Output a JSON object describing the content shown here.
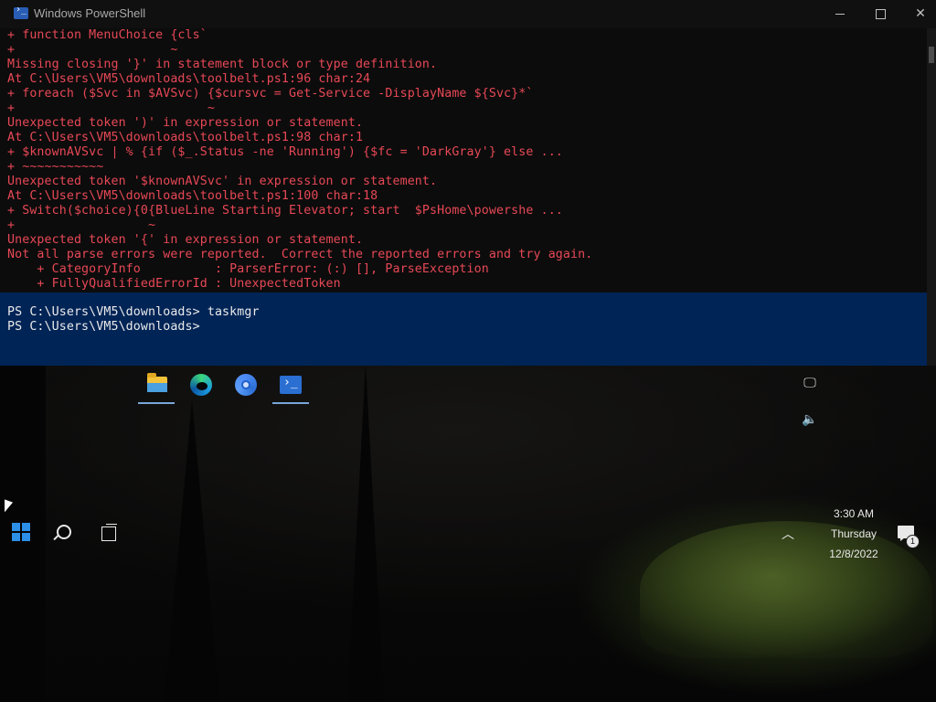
{
  "window": {
    "title": "Windows PowerShell",
    "controls": {
      "minimize": "minimize",
      "maximize": "maximize",
      "close": "✕"
    }
  },
  "console": {
    "error_lines": [
      "+ function MenuChoice {cls`",
      "+                     ~",
      "Missing closing '}' in statement block or type definition.",
      "At C:\\Users\\VM5\\downloads\\toolbelt.ps1:96 char:24",
      "+ foreach ($Svc in $AVSvc) {$cursvc = Get-Service -DisplayName ${Svc}*`",
      "+                          ~",
      "Unexpected token ')' in expression or statement.",
      "At C:\\Users\\VM5\\downloads\\toolbelt.ps1:98 char:1",
      "+ $knownAVSvc | % {if ($_.Status -ne 'Running') {$fc = 'DarkGray'} else ...",
      "+ ~~~~~~~~~~~",
      "Unexpected token '$knownAVSvc' in expression or statement.",
      "At C:\\Users\\VM5\\downloads\\toolbelt.ps1:100 char:18",
      "+ Switch($choice){0{BlueLine Starting Elevator; start  $PsHome\\powershe ...",
      "+                  ~",
      "Unexpected token '{' in expression or statement.",
      "Not all parse errors were reported.  Correct the reported errors and try again.",
      "    + CategoryInfo          : ParserError: (:) [], ParseException",
      "    + FullyQualifiedErrorId : UnexpectedToken"
    ],
    "prompt_lines": [
      "PS C:\\Users\\VM5\\downloads> taskmgr",
      "PS C:\\Users\\VM5\\downloads>"
    ]
  },
  "taskbar": {
    "pinned_apps": [
      "file-explorer",
      "microsoft-edge",
      "google-chrome",
      "windows-powershell"
    ],
    "tray": {
      "time": "3:30 AM",
      "day": "Thursday",
      "date": "12/8/2022",
      "notification_count": "1"
    }
  },
  "colors": {
    "console_bg": "#0c0c0c",
    "prompt_bg": "#012456",
    "error_text": "#e74856",
    "prompt_text": "#eaeaea"
  }
}
